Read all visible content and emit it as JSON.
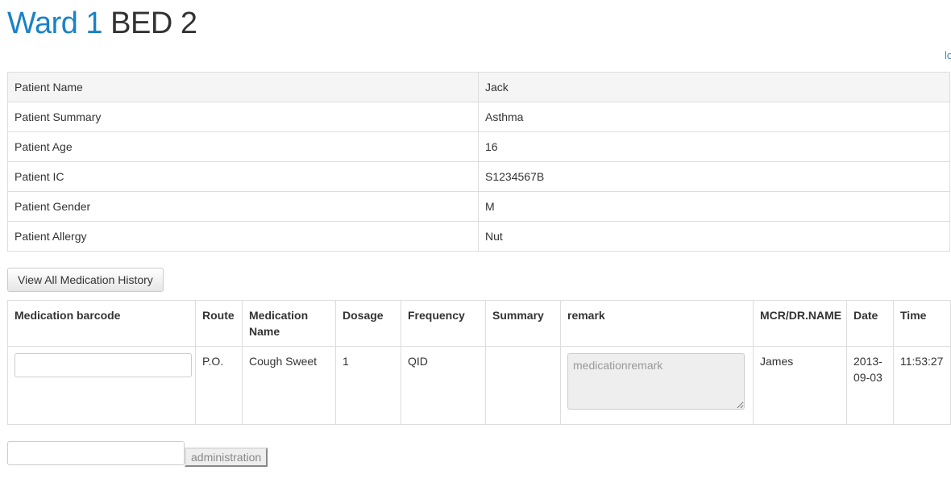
{
  "header": {
    "ward": "Ward 1",
    "bed": "BED 2",
    "link_text": "lo"
  },
  "patient": {
    "rows": [
      {
        "label": "Patient Name",
        "value": "Jack"
      },
      {
        "label": "Patient Summary",
        "value": "Asthma"
      },
      {
        "label": "Patient Age",
        "value": "16"
      },
      {
        "label": "Patient IC",
        "value": "S1234567B"
      },
      {
        "label": "Patient Gender",
        "value": "M"
      },
      {
        "label": "Patient Allergy",
        "value": "Nut"
      }
    ]
  },
  "history_button": "View All Medication History",
  "medication": {
    "columns": [
      "Medication barcode",
      "Route",
      "Medication Name",
      "Dosage",
      "Frequency",
      "Summary",
      "remark",
      "MCR/DR.NAME",
      "Date",
      "Time"
    ],
    "row": {
      "barcode_value": "",
      "route": "P.O.",
      "name": "Cough Sweet",
      "dosage": "1",
      "frequency": "QID",
      "summary": "",
      "remark_placeholder": "medicationremark",
      "doctor": "James",
      "date": "2013-09-03",
      "time": "11:53:27"
    }
  },
  "administration": {
    "input_value": "",
    "button_label": "administration"
  },
  "colors": {
    "accent": "#1a82c6",
    "border": "#dddddd",
    "header_row_bg": "#f5f5f5"
  }
}
